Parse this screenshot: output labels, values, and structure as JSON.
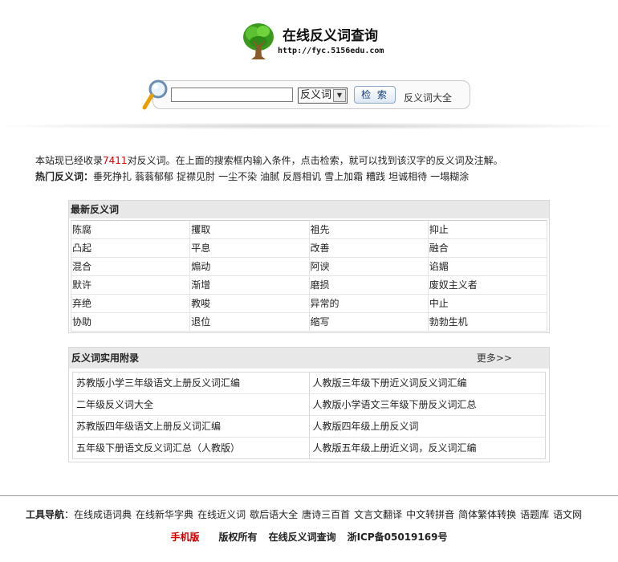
{
  "header": {
    "title": "在线反义词查询",
    "url": "http://fyc.5156edu.com"
  },
  "search": {
    "input_value": "",
    "select_value": "反义词",
    "button_label": "检 索",
    "all_link": "反义词大全"
  },
  "intro": {
    "prefix": "本站现已经收录",
    "count": "7411",
    "suffix": "对反义词。在上面的搜索框内输入条件，点击检索，就可以找到该汉字的反义词及注解。",
    "hot_label": "热门反义词：",
    "hot_words": [
      "垂死挣扎",
      "蓊蓊郁郁",
      "捉襟见肘",
      "一尘不染",
      "油腻",
      "反唇相讥",
      "雪上加霜",
      "糟践",
      "坦诚相待",
      "一塌糊涂"
    ]
  },
  "latest": {
    "title": "最新反义词",
    "rows": [
      [
        "陈腐",
        "攫取",
        "祖先",
        "抑止"
      ],
      [
        "凸起",
        "平息",
        "改善",
        "融合"
      ],
      [
        "混合",
        "煽动",
        "阿谀",
        "谄媚"
      ],
      [
        "默许",
        "渐增",
        "磨损",
        "废奴主义者"
      ],
      [
        "弃绝",
        "教唆",
        "异常的",
        "中止"
      ],
      [
        "协助",
        "退位",
        "缩写",
        "勃勃生机"
      ]
    ]
  },
  "appendix": {
    "title": "反义词实用附录",
    "more": "更多>>",
    "rows": [
      [
        "苏教版小学三年级语文上册反义词汇编",
        "人教版三年级下册近义词反义词汇编"
      ],
      [
        "二年级反义词大全",
        "人教版小学语文三年级下册反义词汇总"
      ],
      [
        "苏教版四年级语文上册反义词汇编",
        "人教版四年级上册反义词"
      ],
      [
        "五年级下册语文反义词汇总（人教版）",
        "人教版五年级上册近义词，反义词汇编"
      ]
    ]
  },
  "footer": {
    "tool_label": "工具导航",
    "tool_colon": "：",
    "tools": [
      "在线成语词典",
      "在线新华字典",
      "在线近义词",
      "歇后语大全",
      "唐诗三百首",
      "文言文翻译",
      "中文转拼音",
      "简体繁体转换",
      "语题库",
      "语文网"
    ],
    "mobile": "手机版",
    "copyright": "版权所有",
    "site_name": "在线反义词查询",
    "icp": "浙ICP备05019169号"
  },
  "colors": {
    "accent_red": "#d40000",
    "panel_head_bg": "#e8e8e8"
  }
}
